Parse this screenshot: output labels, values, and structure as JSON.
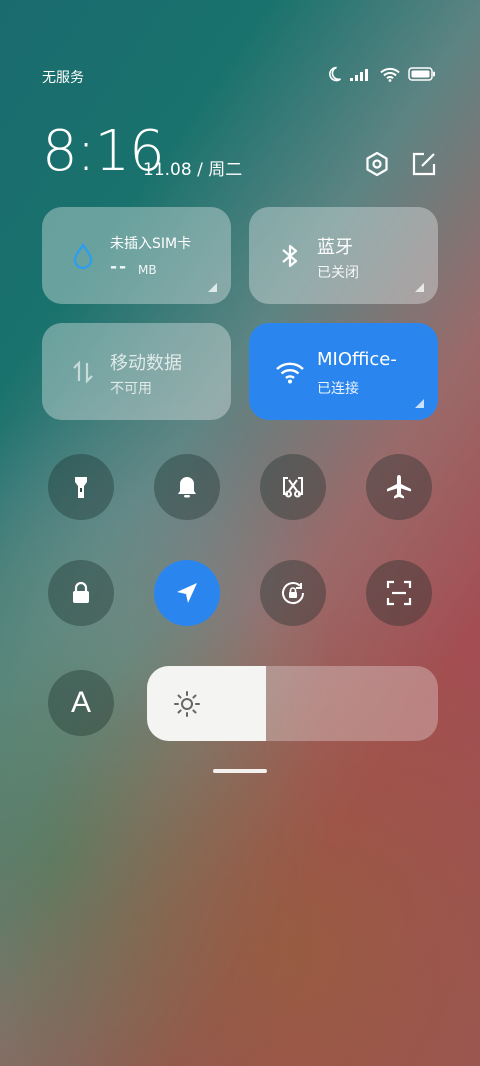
{
  "status_bar": {
    "carrier": "无服务",
    "icons": [
      "moon-icon",
      "signal-icon",
      "wifi-icon",
      "battery-icon"
    ]
  },
  "header": {
    "time": "8:16",
    "date": "11.08 / 周二",
    "icons": [
      "settings-icon",
      "edit-icon"
    ]
  },
  "tiles": {
    "sim": {
      "title": "未插入SIM卡",
      "value": "-- ",
      "unit": "MB",
      "icon": "water-drop-icon"
    },
    "bluetooth": {
      "title": "蓝牙",
      "status": "已关闭",
      "icon": "bluetooth-icon"
    },
    "mobile_data": {
      "title": "移动数据",
      "status": "不可用",
      "icon": "data-arrows-icon"
    },
    "wifi": {
      "title": "MIOffice-",
      "status": "已连接",
      "icon": "wifi-icon"
    }
  },
  "toggles_row1": [
    "flashlight-icon",
    "bell-icon",
    "screenshot-icon",
    "airplane-icon"
  ],
  "toggles_row2": [
    "lock-icon",
    "location-icon",
    "rotation-lock-icon",
    "scan-icon"
  ],
  "font_button": {
    "label": "A"
  },
  "brightness": {
    "level": 0.41,
    "icon": "sun-icon"
  },
  "colors": {
    "accent": "#2a86ee",
    "tile_bg": "rgba(235,240,238,0.38)",
    "drop_icon": "#2a9df4"
  }
}
